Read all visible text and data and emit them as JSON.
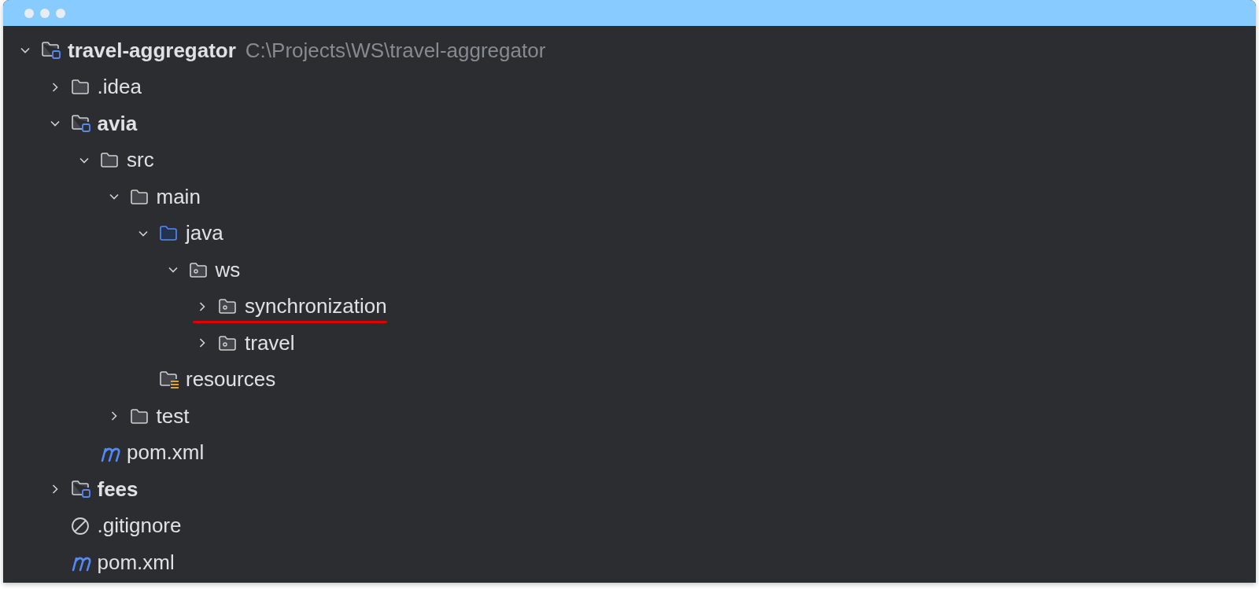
{
  "tree": [
    {
      "kind": "module",
      "label": "travel-aggregator",
      "path": "C:\\Projects\\WS\\travel-aggregator",
      "expanded": true,
      "underlined": false,
      "children": [
        {
          "kind": "folder",
          "label": ".idea",
          "expanded": false,
          "underlined": false
        },
        {
          "kind": "module",
          "label": "avia",
          "expanded": true,
          "underlined": false,
          "children": [
            {
              "kind": "folder",
              "label": "src",
              "expanded": true,
              "underlined": false,
              "children": [
                {
                  "kind": "folder",
                  "label": "main",
                  "expanded": true,
                  "underlined": false,
                  "children": [
                    {
                      "kind": "source",
                      "label": "java",
                      "expanded": true,
                      "underlined": false,
                      "children": [
                        {
                          "kind": "package",
                          "label": "ws",
                          "expanded": true,
                          "underlined": false,
                          "children": [
                            {
                              "kind": "package",
                              "label": "synchronization",
                              "expanded": false,
                              "underlined": true
                            },
                            {
                              "kind": "package",
                              "label": "travel",
                              "expanded": false,
                              "underlined": false
                            }
                          ]
                        }
                      ]
                    },
                    {
                      "kind": "resources",
                      "label": "resources",
                      "underlined": false
                    }
                  ]
                },
                {
                  "kind": "folder",
                  "label": "test",
                  "expanded": false,
                  "underlined": false
                }
              ]
            },
            {
              "kind": "maven",
              "label": "pom.xml",
              "underlined": false
            }
          ]
        },
        {
          "kind": "module",
          "label": "fees",
          "expanded": false,
          "underlined": false
        },
        {
          "kind": "gitignore",
          "label": ".gitignore",
          "underlined": false
        },
        {
          "kind": "maven",
          "label": "pom.xml",
          "underlined": false
        }
      ]
    }
  ]
}
